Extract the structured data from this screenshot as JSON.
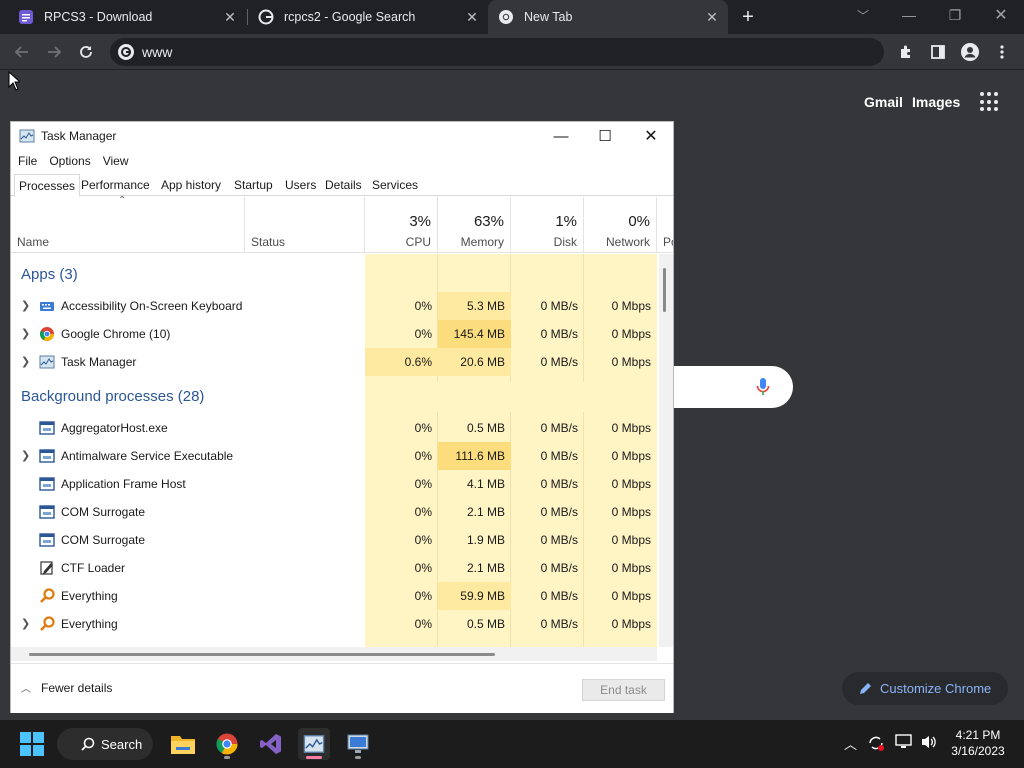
{
  "browser": {
    "tabs": [
      {
        "title": "RPCS3 - Download",
        "active": false
      },
      {
        "title": "rcpcs2 - Google Search",
        "active": false
      },
      {
        "title": "New Tab",
        "active": true
      }
    ],
    "new_tab_symbol": "+",
    "address": "www",
    "ntp": {
      "gmail": "Gmail",
      "images": "Images",
      "customize": "Customize Chrome"
    }
  },
  "task_manager": {
    "title": "Task Manager",
    "menu": [
      "File",
      "Options",
      "View"
    ],
    "tabs": [
      "Processes",
      "Performance",
      "App history",
      "Startup",
      "Users",
      "Details",
      "Services"
    ],
    "selected_tab": "Processes",
    "columns": {
      "name": "Name",
      "status": "Status",
      "cpu": {
        "pct": "3%",
        "label": "CPU"
      },
      "memory": {
        "pct": "63%",
        "label": "Memory"
      },
      "disk": {
        "pct": "1%",
        "label": "Disk"
      },
      "network": {
        "pct": "0%",
        "label": "Network"
      },
      "power_partial": "Po"
    },
    "groups": {
      "apps": "Apps (3)",
      "background": "Background processes (28)"
    },
    "apps": [
      {
        "name": "Accessibility On-Screen Keyboard",
        "cpu": "0%",
        "memory": "5.3 MB",
        "disk": "0 MB/s",
        "network": "0 Mbps",
        "expandable": true,
        "icon": "keyboard-icon"
      },
      {
        "name": "Google Chrome (10)",
        "cpu": "0%",
        "memory": "145.4 MB",
        "disk": "0 MB/s",
        "network": "0 Mbps",
        "expandable": true,
        "icon": "chrome-icon"
      },
      {
        "name": "Task Manager",
        "cpu": "0.6%",
        "memory": "20.6 MB",
        "disk": "0 MB/s",
        "network": "0 Mbps",
        "expandable": true,
        "icon": "task-manager-icon"
      }
    ],
    "background": [
      {
        "name": "AggregatorHost.exe",
        "cpu": "0%",
        "memory": "0.5 MB",
        "disk": "0 MB/s",
        "network": "0 Mbps",
        "expandable": false,
        "icon": "app-window-icon"
      },
      {
        "name": "Antimalware Service Executable",
        "cpu": "0%",
        "memory": "111.6 MB",
        "disk": "0 MB/s",
        "network": "0 Mbps",
        "expandable": true,
        "icon": "app-window-icon"
      },
      {
        "name": "Application Frame Host",
        "cpu": "0%",
        "memory": "4.1 MB",
        "disk": "0 MB/s",
        "network": "0 Mbps",
        "expandable": false,
        "icon": "app-window-icon"
      },
      {
        "name": "COM Surrogate",
        "cpu": "0%",
        "memory": "2.1 MB",
        "disk": "0 MB/s",
        "network": "0 Mbps",
        "expandable": false,
        "icon": "app-window-icon"
      },
      {
        "name": "COM Surrogate",
        "cpu": "0%",
        "memory": "1.9 MB",
        "disk": "0 MB/s",
        "network": "0 Mbps",
        "expandable": false,
        "icon": "app-window-icon"
      },
      {
        "name": "CTF Loader",
        "cpu": "0%",
        "memory": "2.1 MB",
        "disk": "0 MB/s",
        "network": "0 Mbps",
        "expandable": false,
        "icon": "ctf-loader-icon"
      },
      {
        "name": "Everything",
        "cpu": "0%",
        "memory": "59.9 MB",
        "disk": "0 MB/s",
        "network": "0 Mbps",
        "expandable": false,
        "icon": "everything-search-icon"
      },
      {
        "name": "Everything",
        "cpu": "0%",
        "memory": "0.5 MB",
        "disk": "0 MB/s",
        "network": "0 Mbps",
        "expandable": true,
        "icon": "everything-search-icon"
      }
    ],
    "footer": {
      "fewer_details": "Fewer details",
      "end_task": "End task"
    }
  },
  "taskbar": {
    "search": "Search",
    "time": "4:21 PM",
    "date": "3/16/2023"
  },
  "colors": {
    "chrome_dark": "#202124",
    "chrome_ntp": "#35363a",
    "heat_light": "#fff4c4",
    "heat_medium": "#fde9a0",
    "group_blue": "#2b5797",
    "accent": "#8ab4f8"
  }
}
